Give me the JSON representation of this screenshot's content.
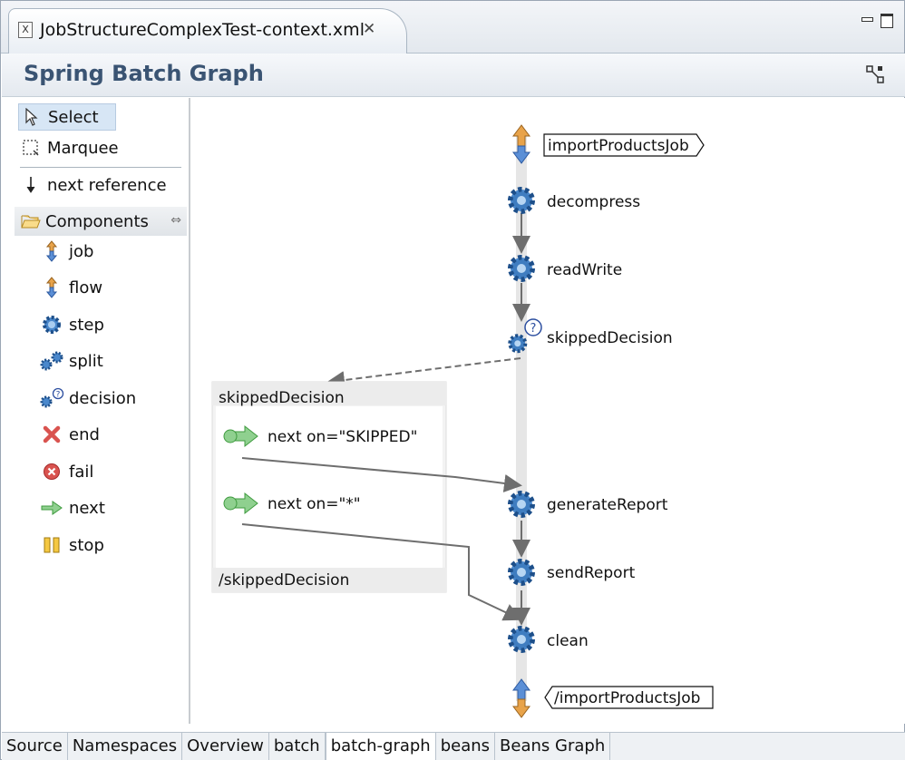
{
  "editor": {
    "tab_title": "JobStructureComplexTest-context.xml",
    "file_icon": "xml-file-icon"
  },
  "header": {
    "title": "Spring Batch Graph"
  },
  "palette": {
    "tools": [
      {
        "label": "Select",
        "icon": "arrow-pointer-icon",
        "selected": true
      },
      {
        "label": "Marquee",
        "icon": "marquee-icon",
        "selected": false
      },
      {
        "label": "next reference",
        "icon": "down-arrow-icon",
        "selected": false
      }
    ],
    "drawer_label": "Components",
    "components": [
      {
        "label": "job",
        "icon": "job-icon"
      },
      {
        "label": "flow",
        "icon": "flow-icon"
      },
      {
        "label": "step",
        "icon": "step-gear-icon"
      },
      {
        "label": "split",
        "icon": "split-gears-icon"
      },
      {
        "label": "decision",
        "icon": "decision-icon"
      },
      {
        "label": "end",
        "icon": "end-x-icon"
      },
      {
        "label": "fail",
        "icon": "fail-icon"
      },
      {
        "label": "next",
        "icon": "next-arrow-icon"
      },
      {
        "label": "stop",
        "icon": "stop-icon"
      }
    ]
  },
  "graph": {
    "job_start": "importProductsJob",
    "job_end": "/importProductsJob",
    "steps": [
      "decompress",
      "readWrite",
      "skippedDecision",
      "generateReport",
      "sendReport",
      "clean"
    ],
    "decision_box": {
      "title": "skippedDecision",
      "footer": "/skippedDecision",
      "transitions": [
        "next on=\"SKIPPED\"",
        "next on=\"*\""
      ]
    }
  },
  "bottom_tabs": [
    {
      "label": "Source",
      "active": false
    },
    {
      "label": "Namespaces",
      "active": false
    },
    {
      "label": "Overview",
      "active": false
    },
    {
      "label": "batch",
      "active": false
    },
    {
      "label": "batch-graph",
      "active": true
    },
    {
      "label": "beans",
      "active": false
    },
    {
      "label": "Beans Graph",
      "active": false
    }
  ],
  "colors": {
    "title_text": "#3a5473",
    "gear_blue": "#3b7fc4",
    "next_green": "#5cb85c",
    "edge_gray": "#6e6e6e",
    "selection_bg": "#d7e6f5"
  }
}
